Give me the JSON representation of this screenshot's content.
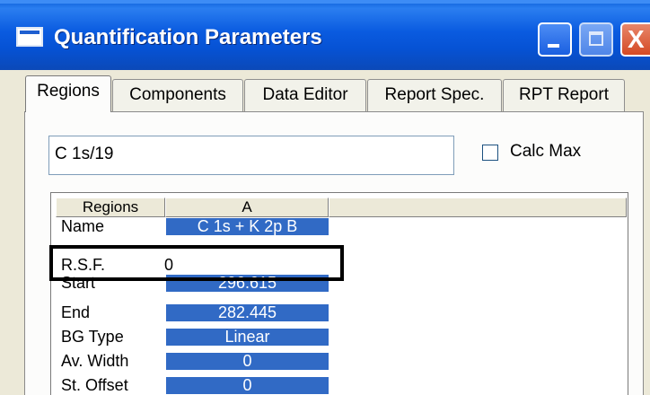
{
  "window": {
    "title": "Quantification Parameters",
    "icon": "window-icon",
    "controls": [
      "minimize-icon",
      "maximize-icon",
      "close-icon"
    ],
    "close_glyph": "X"
  },
  "tabs": [
    {
      "label": "Regions",
      "active": true
    },
    {
      "label": "Components",
      "active": false
    },
    {
      "label": "Data Editor",
      "active": false
    },
    {
      "label": "Report Spec.",
      "active": false
    },
    {
      "label": "RPT Report",
      "active": false
    }
  ],
  "region_name": "C 1s/19",
  "calc_max": {
    "label": "Calc Max",
    "checked": false
  },
  "grid": {
    "headers": [
      "Regions",
      "A",
      ""
    ],
    "rows": [
      {
        "label": "Name",
        "value": "C 1s + K 2p B"
      },
      {
        "label": "R.S.F.",
        "value": "0"
      },
      {
        "label": "Start",
        "value": "296.615"
      },
      {
        "label": "End",
        "value": "282.445"
      },
      {
        "label": "BG Type",
        "value": "Linear"
      },
      {
        "label": "Av. Width",
        "value": "0"
      },
      {
        "label": "St. Offset",
        "value": "0"
      }
    ]
  },
  "colors": {
    "titlebar": "#0a5be0",
    "selection": "#316ac5",
    "face": "#ece9d8"
  }
}
